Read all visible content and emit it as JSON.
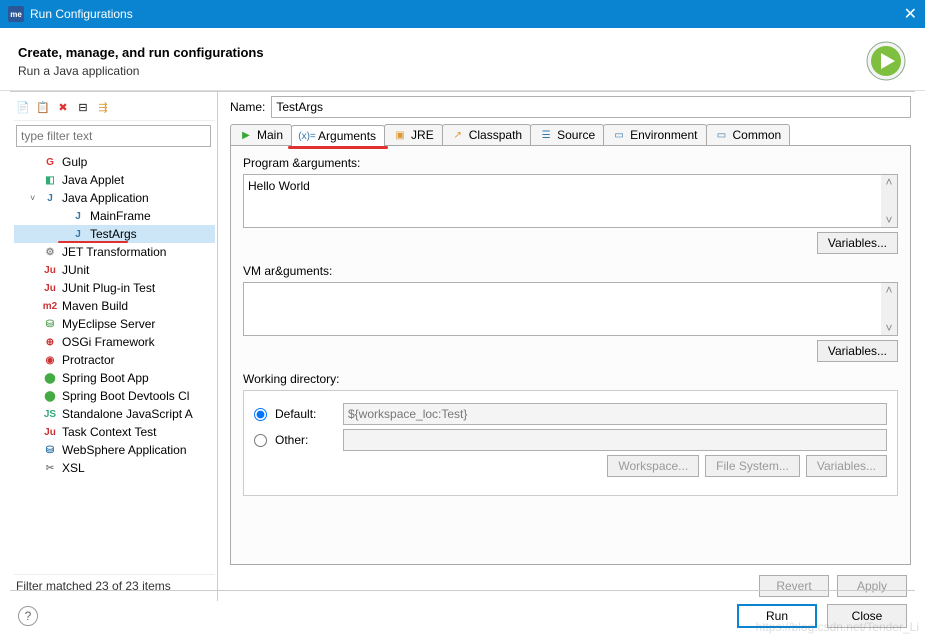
{
  "window": {
    "title": "Run Configurations"
  },
  "header": {
    "title": "Create, manage, and run configurations",
    "subtitle": "Run a Java application"
  },
  "filter": {
    "placeholder": "type filter text",
    "status": "Filter matched 23 of 23 items"
  },
  "tree": {
    "items": [
      {
        "label": "Gulp",
        "icon": "G",
        "iconColor": "#d33",
        "lvl": 1
      },
      {
        "label": "Java Applet",
        "icon": "◧",
        "iconColor": "#3a7",
        "lvl": 1
      },
      {
        "label": "Java Application",
        "icon": "J",
        "iconColor": "#37a",
        "lvl": 1,
        "expanded": true
      },
      {
        "label": "MainFrame",
        "icon": "J",
        "iconColor": "#37a",
        "lvl": 2
      },
      {
        "label": "TestArgs",
        "icon": "J",
        "iconColor": "#37a",
        "lvl": 2,
        "selected": true,
        "underline": true
      },
      {
        "label": "JET Transformation",
        "icon": "⚙",
        "iconColor": "#888",
        "lvl": 1
      },
      {
        "label": "JUnit",
        "icon": "Ju",
        "iconColor": "#c33",
        "lvl": 1
      },
      {
        "label": "JUnit Plug-in Test",
        "icon": "Ju",
        "iconColor": "#c33",
        "lvl": 1
      },
      {
        "label": "Maven Build",
        "icon": "m2",
        "iconColor": "#c33",
        "lvl": 1
      },
      {
        "label": "MyEclipse Server",
        "icon": "⛁",
        "iconColor": "#6a6",
        "lvl": 1
      },
      {
        "label": "OSGi Framework",
        "icon": "⊕",
        "iconColor": "#c33",
        "lvl": 1
      },
      {
        "label": "Protractor",
        "icon": "◉",
        "iconColor": "#c33",
        "lvl": 1
      },
      {
        "label": "Spring Boot App",
        "icon": "⬤",
        "iconColor": "#4a4",
        "lvl": 1
      },
      {
        "label": "Spring Boot Devtools Cl",
        "icon": "⬤",
        "iconColor": "#4a4",
        "lvl": 1
      },
      {
        "label": "Standalone JavaScript A",
        "icon": "JS",
        "iconColor": "#3a7",
        "lvl": 1
      },
      {
        "label": "Task Context Test",
        "icon": "Ju",
        "iconColor": "#c33",
        "lvl": 1
      },
      {
        "label": "WebSphere Application",
        "icon": "⛁",
        "iconColor": "#37a",
        "lvl": 1
      },
      {
        "label": "XSL",
        "icon": "✂",
        "iconColor": "#888",
        "lvl": 1
      }
    ]
  },
  "name": {
    "label": "Name:",
    "value": "TestArgs"
  },
  "tabs": {
    "items": [
      {
        "label": "Main",
        "icon": "▶",
        "iconColor": "#3a3"
      },
      {
        "label": "Arguments",
        "icon": "(x)=",
        "iconColor": "#37a",
        "active": true,
        "underline": true
      },
      {
        "label": "JRE",
        "icon": "▣",
        "iconColor": "#d93"
      },
      {
        "label": "Classpath",
        "icon": "↗",
        "iconColor": "#d93"
      },
      {
        "label": "Source",
        "icon": "☰",
        "iconColor": "#37a"
      },
      {
        "label": "Environment",
        "icon": "▭",
        "iconColor": "#37a"
      },
      {
        "label": "Common",
        "icon": "▭",
        "iconColor": "#37a"
      }
    ]
  },
  "args": {
    "program_label": "Program &arguments:",
    "program_value": "Hello World",
    "vm_label": "VM ar&guments:",
    "vm_value": "",
    "variables_btn": "Variables...",
    "workdir_label": "Working directory:",
    "default_label": "Default:",
    "default_value": "${workspace_loc:Test}",
    "other_label": "Other:",
    "workspace_btn": "Workspace...",
    "filesystem_btn": "File System...",
    "variables2_btn": "Variables..."
  },
  "buttons": {
    "revert": "Revert",
    "apply": "Apply",
    "run": "Run",
    "close": "Close"
  },
  "watermark": "https://blog.csdn.net/Tender_Li"
}
